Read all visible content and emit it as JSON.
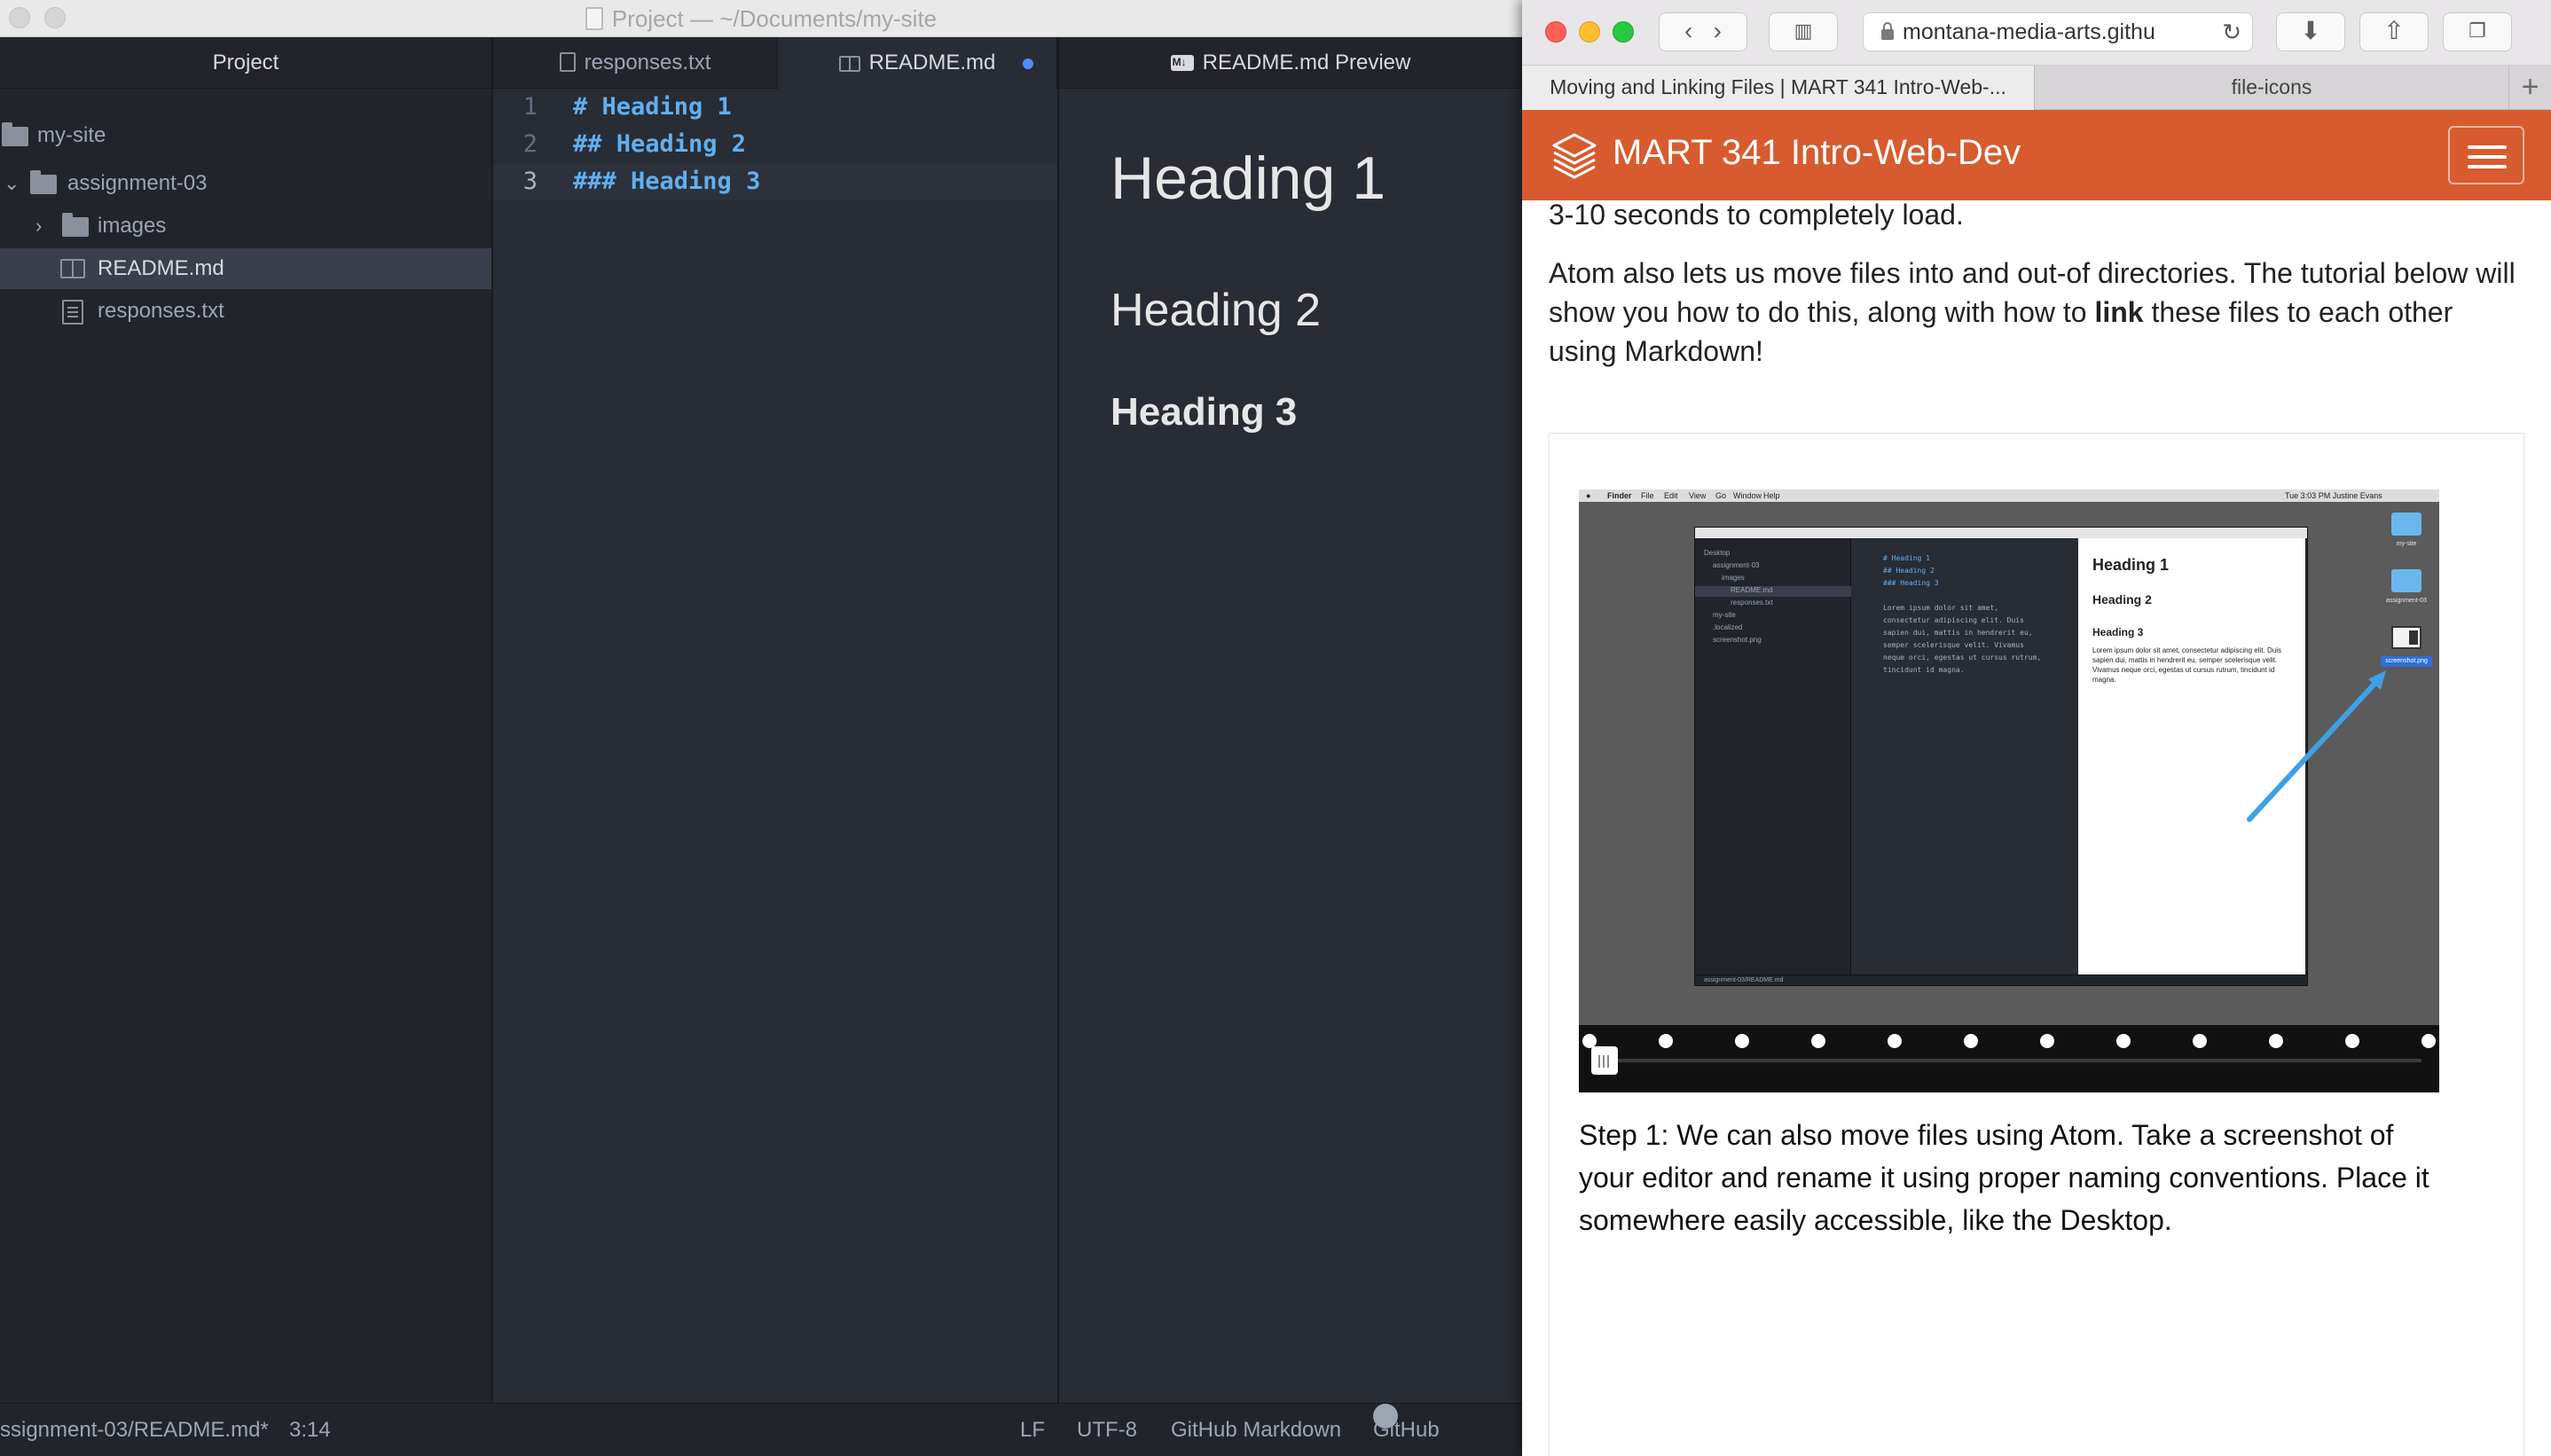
{
  "atom": {
    "window_title": "Project — ~/Documents/my-site",
    "tree": {
      "header": "Project",
      "items": [
        {
          "label": "my-site"
        },
        {
          "label": "assignment-03"
        },
        {
          "label": "images"
        },
        {
          "label": "README.md"
        },
        {
          "label": "responses.txt"
        }
      ]
    },
    "tabs": [
      {
        "label": "responses.txt"
      },
      {
        "label": "README.md"
      }
    ],
    "code_lines": [
      {
        "num": "1",
        "text": "# Heading 1"
      },
      {
        "num": "2",
        "text": "## Heading 2"
      },
      {
        "num": "3",
        "text": "### Heading 3"
      }
    ],
    "preview": {
      "tab_label": "README.md Preview",
      "h1": "Heading 1",
      "h2": "Heading 2",
      "h3": "Heading 3"
    },
    "status": {
      "path": "ssignment-03/README.md*",
      "cursor": "3:14",
      "line_ending": "LF",
      "encoding": "UTF-8",
      "grammar": "GitHub Markdown",
      "github": "GitHub"
    }
  },
  "safari": {
    "url": "montana-media-arts.githu",
    "tabs": [
      {
        "label": "Moving and Linking Files | MART 341 Intro-Web-..."
      },
      {
        "label": "file-icons"
      }
    ],
    "new_tab": "+",
    "site_title": "MART 341 Intro-Web-Dev",
    "article": {
      "p0": "3-10 seconds to completely load.",
      "p1_before": "Atom also lets us move files into and out-of directories. The tutorial below will show you how to do this, along with how to ",
      "p1_bold": "link",
      "p1_after": " these files to each other using Markdown!",
      "step1": "Step 1: We can also move files using Atom. Take a screenshot of your editor and rename it using proper naming conventions. Place it somewhere easily accessible, like the Desktop."
    },
    "screenshot": {
      "menubar": [
        "Finder",
        "File",
        "Edit",
        "View",
        "Go",
        "Window",
        "Help"
      ],
      "menubar_right": "Tue 3:03 PM   Justine Evans",
      "tree": [
        "Desktop",
        "assignment-03",
        "images",
        "README.md",
        "responses.txt",
        "my-site",
        ".localized",
        "screenshot.png"
      ],
      "code": [
        "# Heading 1",
        "## Heading 2",
        "### Heading 3"
      ],
      "lorem_code": [
        "Lorem ipsum dolor sit amet,",
        "consectetur adipiscing elit. Duis",
        "sapien dui, mattis in hendrerit eu,",
        "semper scelerisque velit. Vivamus",
        "neque orci, egestas ut cursus rutrum,",
        "tincidunt id magna."
      ],
      "preview_h1": "Heading 1",
      "preview_h2": "Heading 2",
      "preview_h3": "Heading 3",
      "preview_p": "Lorem ipsum dolor sit amet, consectetur adipiscing elit. Duis sapien dui, mattis in hendrerit eu, semper scelerisque velit. Vivamus neque orci, egestas ut cursus rutrum, tincidunt id magna.",
      "status": "assignment-03/README.md",
      "desktop_items": [
        "my-site",
        "assignment-03",
        "screenshot.png"
      ]
    },
    "slide_count": 12,
    "active_slide": 1
  },
  "colors": {
    "site_header": "#d75b2e",
    "markdown_heading": "#61afef",
    "modified_dot": "#528bff"
  }
}
